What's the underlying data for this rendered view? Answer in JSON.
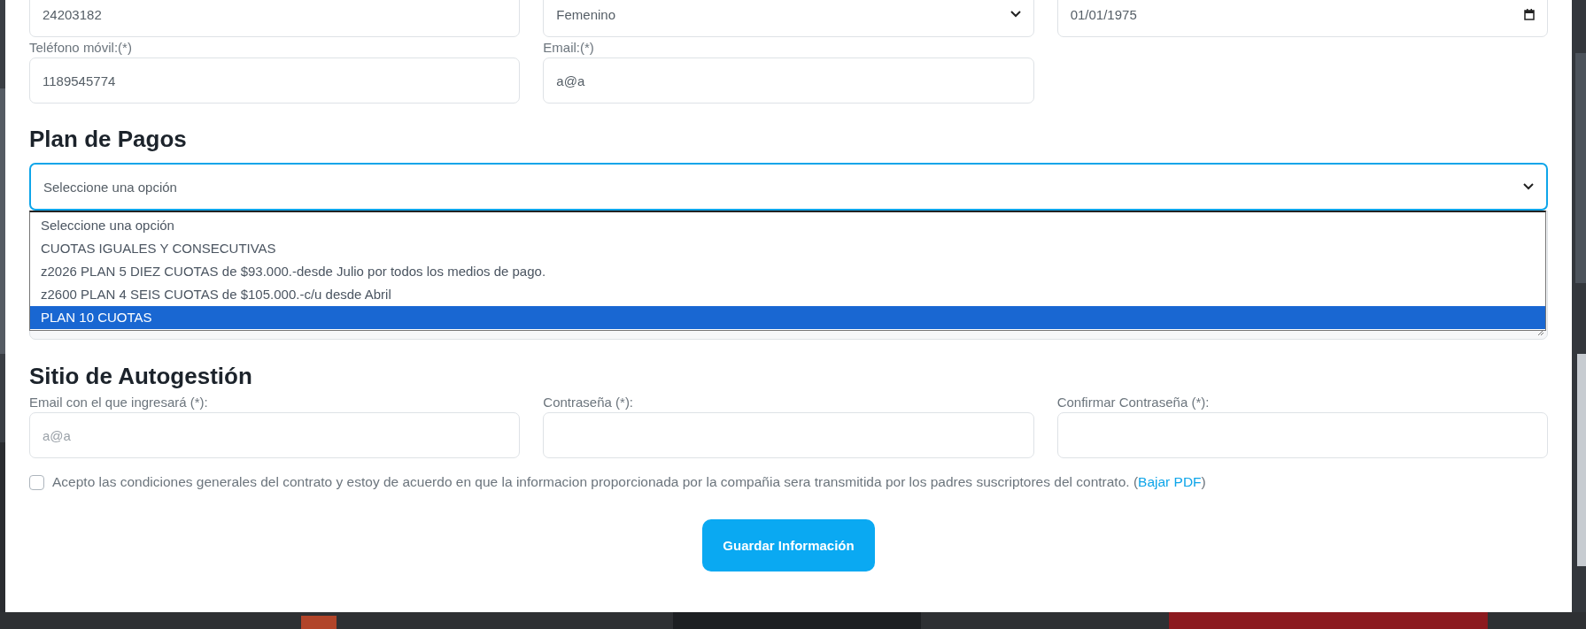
{
  "personal_fields": [
    {
      "kind": "text",
      "value": "24203182"
    },
    {
      "kind": "select",
      "value": "Femenino"
    },
    {
      "kind": "date",
      "value": "01/01/1975"
    },
    {
      "kind": "text",
      "label": "Teléfono móvil:(*)",
      "value": "1189545774"
    },
    {
      "kind": "text",
      "label": "Email:(*)",
      "value": "a@a"
    }
  ],
  "plan": {
    "heading": "Plan de Pagos",
    "select": {
      "value": "Seleccione una opción",
      "expanded": true
    },
    "options": [
      {
        "label": "Seleccione una opción",
        "selected": false
      },
      {
        "label": "CUOTAS IGUALES Y CONSECUTIVAS",
        "selected": false
      },
      {
        "label": "z2026 PLAN 5 DIEZ CUOTAS de $93.000.-desde Julio por todos los medios de pago.",
        "selected": false
      },
      {
        "label": "z2600 PLAN 4 SEIS CUOTAS de $105.000.-c/u desde Abril",
        "selected": false
      },
      {
        "label": "PLAN 10 CUOTAS",
        "selected": true
      }
    ]
  },
  "site": {
    "heading": "Sitio de Autogestión",
    "fields": [
      {
        "label": "Email con el que ingresará (*):",
        "placeholder": "a@a"
      },
      {
        "label": "Contraseña (*):"
      },
      {
        "label": "Confirmar Contraseña (*):"
      }
    ]
  },
  "terms": {
    "checked": false,
    "text": "Acepto las condiciones generales del contrato y estoy de acuerdo en que la informacion proporcionada por la compañia sera transmitida por los padres suscriptores del contrato. (",
    "link": "Bajar PDF",
    "suffix": ")"
  },
  "save_button": "Guardar Información"
}
